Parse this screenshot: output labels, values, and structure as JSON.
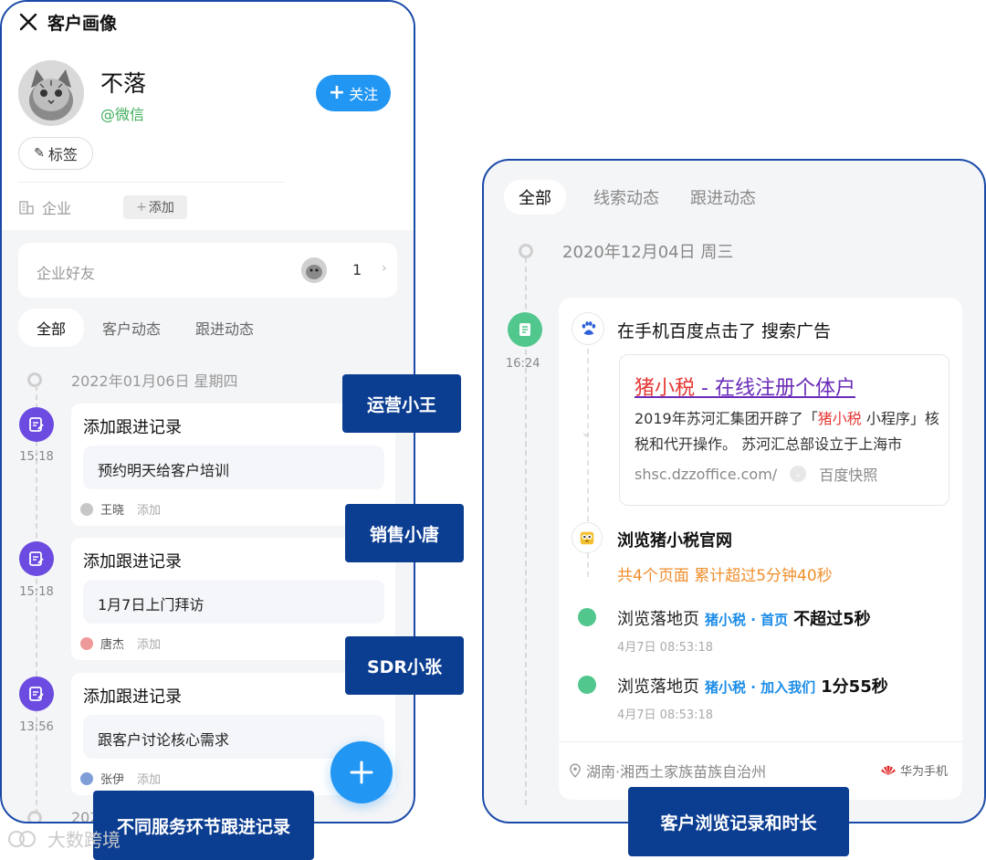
{
  "left_phone": {
    "title": "客户画像",
    "customer_name": "不落",
    "customer_source": "@微信",
    "follow_label": "关注",
    "tag_label": "标签",
    "company_label": "企业",
    "add_label": "添加",
    "friends_label": "企业好友",
    "friends_count": "1",
    "tabs": [
      "全部",
      "客户动态",
      "跟进动态"
    ],
    "date": "2022年01月06日 星期四",
    "date_next": "202",
    "records": [
      {
        "title": "添加跟进记录",
        "time": "15:18",
        "content": "预约明天给客户培训",
        "user": "王晓",
        "user_color": "#c7c7c7",
        "add": "添加"
      },
      {
        "title": "添加跟进记录",
        "time": "15:18",
        "content": "1月7日上门拜访",
        "user": "唐杰",
        "user_color": "#ef9a9a",
        "add": "添加"
      },
      {
        "title": "添加跟进记录",
        "time": "13:56",
        "content": "跟客户讨论核心需求",
        "user": "张伊",
        "user_color": "#7f9ed8",
        "add": "添加"
      }
    ]
  },
  "roles": {
    "role1": "运营小王",
    "role2": "销售小唐",
    "role3": "SDR小张",
    "left_caption": "不同服务环节跟进记录",
    "right_caption": "客户浏览记录和时长"
  },
  "right_phone": {
    "tabs": [
      "全部",
      "线索动态",
      "跟进动态"
    ],
    "date": "2020年12月04日 周三",
    "time": "16:24",
    "action": "在手机百度点击了 搜索广告",
    "ad": {
      "title_red": "猪小税",
      "title_rest": " - 在线注册个体户",
      "desc_pre": "2019年苏河汇集团开辟了「",
      "desc_red": "猪小税",
      "desc_post": " 小程序」核税和代开操作。 苏河汇总部设立于上海市",
      "url": "shsc.dzzoffice.com/",
      "snapshot": "百度快照"
    },
    "site_title": "浏览猪小税官网",
    "site_summary": "共4个页面  累计超过5分钟40秒",
    "visits": [
      {
        "prefix": "浏览落地页",
        "page": "猪小税 · 首页",
        "duration": "不超过5秒",
        "ts": "4月7日 08:53:18"
      },
      {
        "prefix": "浏览落地页",
        "page": "猪小税 · 加入我们",
        "duration": "1分55秒",
        "ts": "4月7日 08:53:18"
      }
    ],
    "location": "湖南·湘西土家族苗族自治州",
    "device": "华为手机"
  },
  "watermark": "大数跨境",
  "colors": {
    "accent_blue": "#2196f3",
    "navy": "#0b3d91",
    "purple": "#6b4be0",
    "green": "#52c78d",
    "orange": "#ef8e2c"
  }
}
